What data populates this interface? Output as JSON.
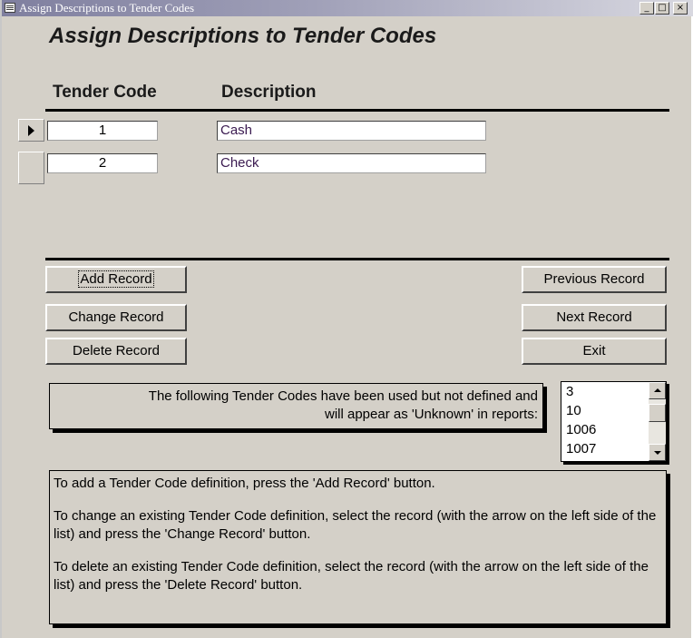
{
  "window": {
    "title": "Assign Descriptions to Tender Codes",
    "minimize": "_",
    "maximize": "□",
    "close": "×"
  },
  "form": {
    "heading": "Assign Descriptions to Tender Codes",
    "column_headers": {
      "code": "Tender Code",
      "description": "Description"
    }
  },
  "records": [
    {
      "code": "1",
      "description": "Cash",
      "selected": true
    },
    {
      "code": "2",
      "description": "Check",
      "selected": false
    }
  ],
  "buttons": {
    "add": "Add Record",
    "change": "Change Record",
    "delete": "Delete Record",
    "previous": "Previous Record",
    "next": "Next Record",
    "exit": "Exit"
  },
  "notice": {
    "line1": "The following Tender Codes have been used but not defined and",
    "line2": "will appear as 'Unknown' in reports:"
  },
  "undefined_codes": [
    "3",
    "10",
    "1006",
    "1007"
  ],
  "instructions": {
    "add": "To add a Tender Code definition, press the 'Add Record' button.",
    "change": "To change an existing Tender Code definition, select the record (with the arrow on the left side of the list) and press the 'Change Record' button.",
    "delete": "To delete an existing Tender Code definition, select the record (with the arrow on the left side of the list) and press the 'Delete Record' button."
  },
  "colors": {
    "form_background": "#d4d0c8",
    "title_gradient_start": "#7f7f9f",
    "description_text": "#3a1a50"
  },
  "icons": {
    "window": "form-icon",
    "record_selector": "triangle-right-icon",
    "scroll_up": "arrow-up-icon",
    "scroll_down": "arrow-down-icon"
  }
}
